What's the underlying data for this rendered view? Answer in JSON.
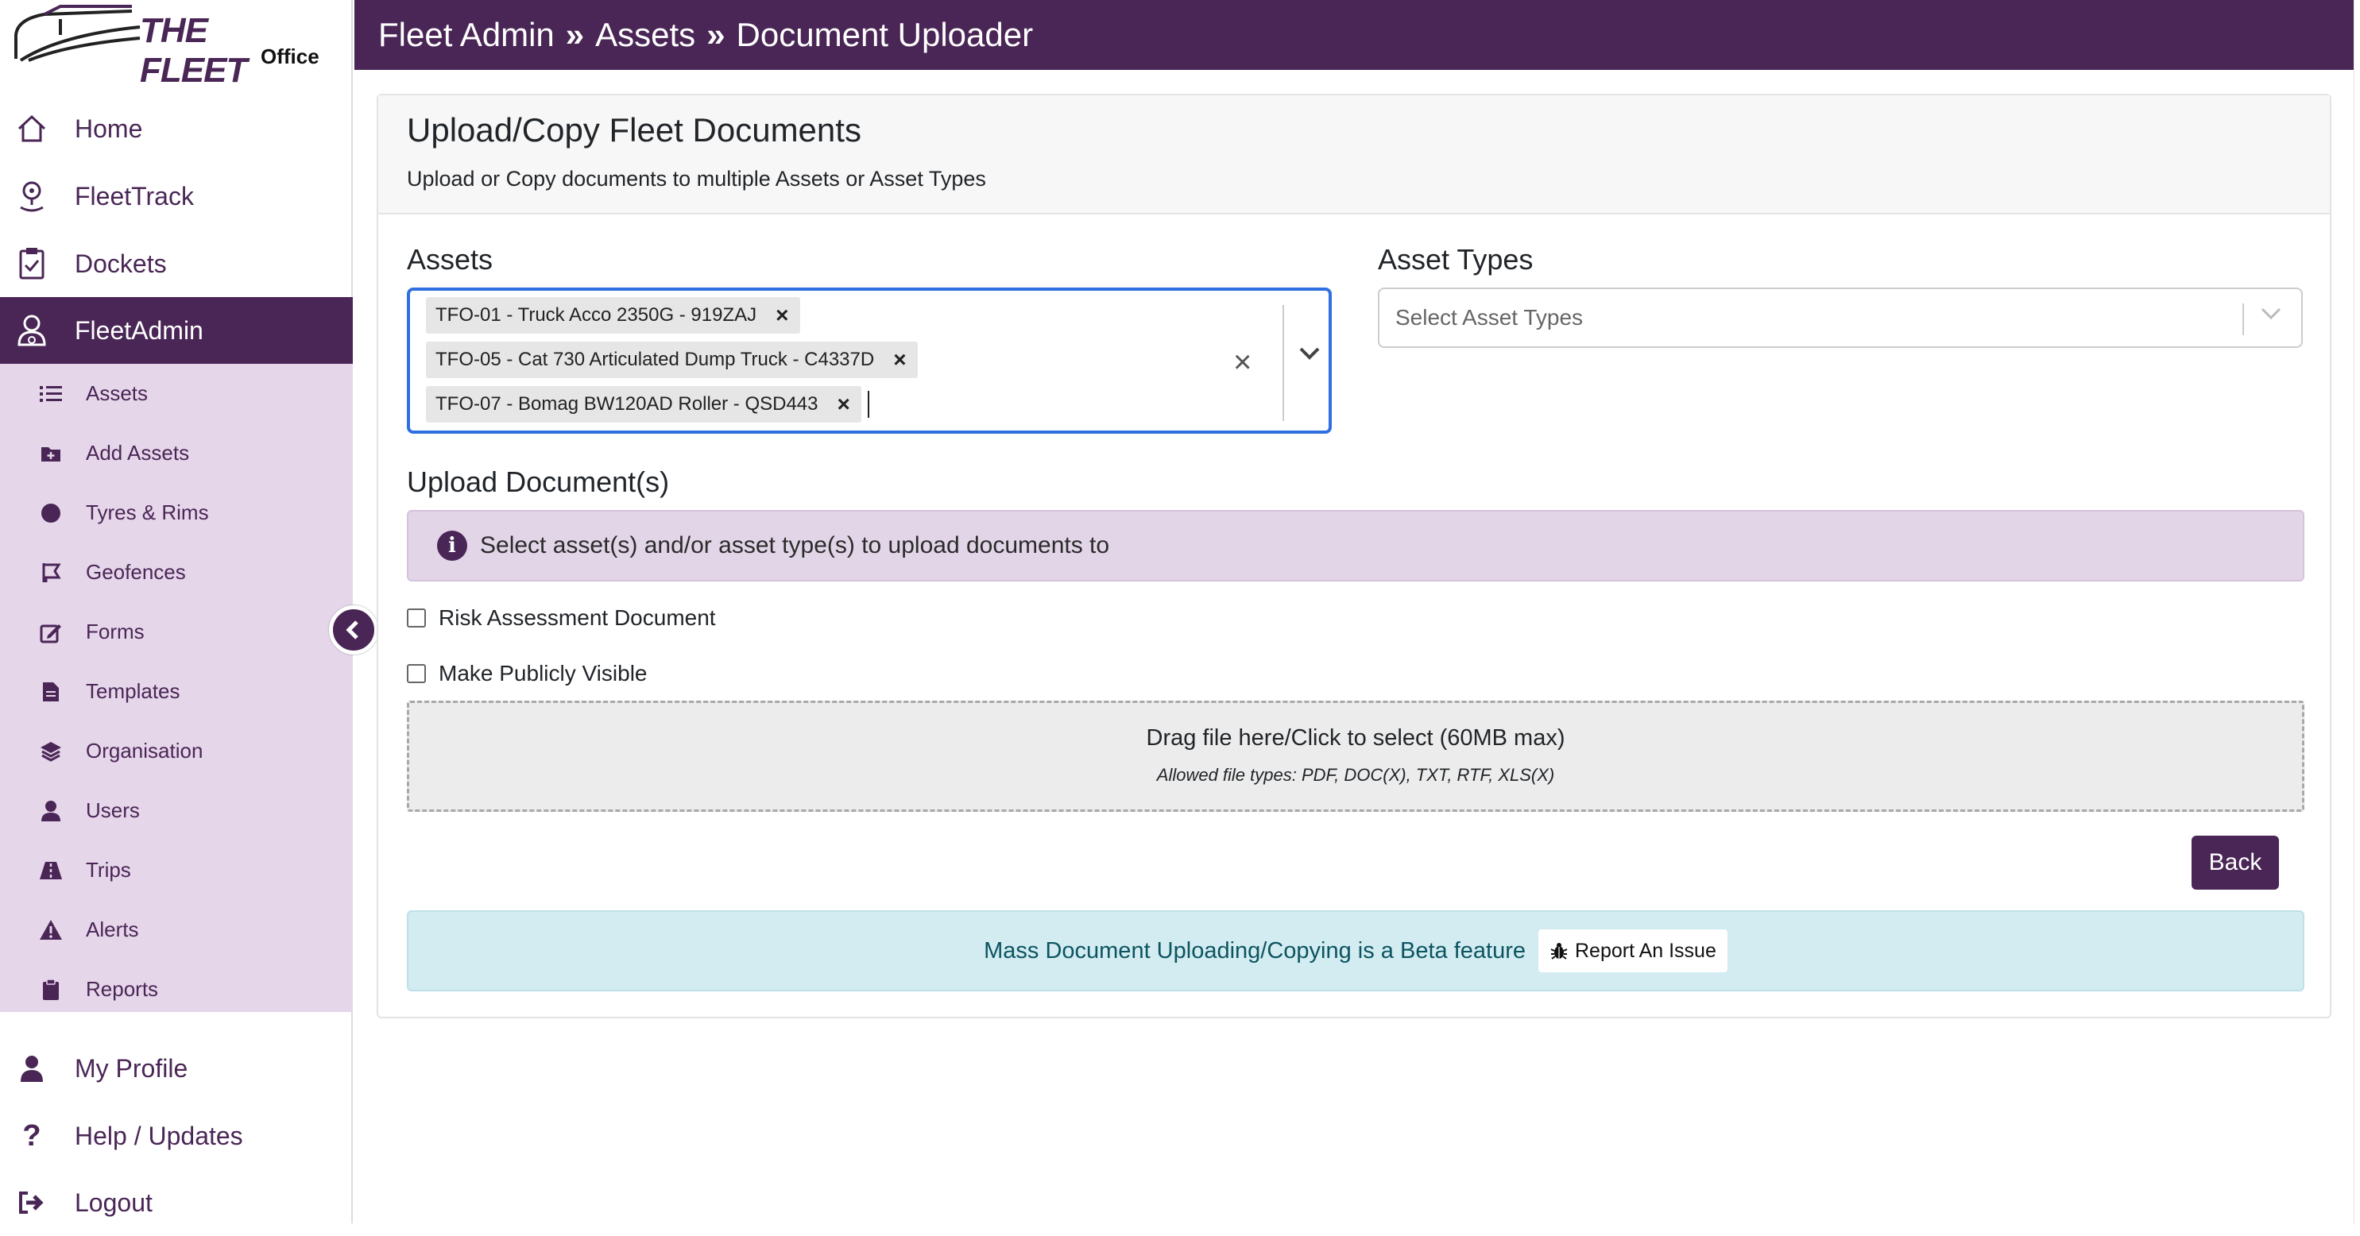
{
  "logo": {
    "title": "THE FLEET",
    "subtitle": "Office"
  },
  "nav": {
    "home": "Home",
    "fleettrack": "FleetTrack",
    "dockets": "Dockets",
    "fleetadmin": "FleetAdmin",
    "profile": "My Profile",
    "help": "Help / Updates",
    "logout": "Logout"
  },
  "submenu": [
    {
      "label": "Assets",
      "icon": "list-icon"
    },
    {
      "label": "Add Assets",
      "icon": "folder-plus-icon"
    },
    {
      "label": "Tyres & Rims",
      "icon": "circle-icon"
    },
    {
      "label": "Geofences",
      "icon": "map-flag-icon"
    },
    {
      "label": "Forms",
      "icon": "edit-icon"
    },
    {
      "label": "Templates",
      "icon": "file-icon"
    },
    {
      "label": "Organisation",
      "icon": "layers-icon"
    },
    {
      "label": "Users",
      "icon": "user-icon"
    },
    {
      "label": "Trips",
      "icon": "road-icon"
    },
    {
      "label": "Alerts",
      "icon": "warning-icon"
    },
    {
      "label": "Reports",
      "icon": "clipboard-icon"
    }
  ],
  "breadcrumb": {
    "part1": "Fleet Admin",
    "part2": "Assets",
    "part3": "Document Uploader",
    "sep": "»"
  },
  "card": {
    "title": "Upload/Copy Fleet Documents",
    "subtitle": "Upload or Copy documents to multiple Assets or Asset Types"
  },
  "assets": {
    "label": "Assets",
    "selected": [
      "TFO-01 - Truck Acco 2350G - 919ZAJ",
      "TFO-05 - Cat 730 Articulated Dump Truck - C4337D",
      "TFO-07 - Bomag BW120AD Roller - QSD443"
    ]
  },
  "asset_types": {
    "label": "Asset Types",
    "placeholder": "Select Asset Types"
  },
  "upload": {
    "label": "Upload Document(s)",
    "info": "Select asset(s) and/or asset type(s) to upload documents to",
    "risk_label": "Risk Assessment Document",
    "public_label": "Make Publicly Visible",
    "drop_line1": "Drag file here/Click to select (60MB max)",
    "drop_line2": "Allowed file types: PDF, DOC(X), TXT, RTF, XLS(X)"
  },
  "back_label": "Back",
  "beta": {
    "text": "Mass Document Uploading/Copying is a Beta feature",
    "button": "Report An Issue"
  },
  "colors": {
    "brand": "#4a2656",
    "submenu_bg": "#e6d6ea",
    "focus_border": "#2f6fe0",
    "beta_bg": "#d2ecf1"
  }
}
